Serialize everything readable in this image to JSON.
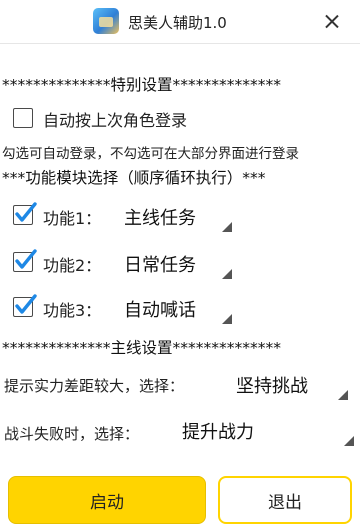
{
  "window": {
    "title": "思美人辅助1.0",
    "close_icon": "close-icon"
  },
  "special": {
    "header": "**************特别设置**************",
    "auto_login": {
      "label": "自动按上次角色登录",
      "checked": false
    },
    "hint": "勾选可自动登录，不勾选可在大部分界面进行登录"
  },
  "modules": {
    "header": "***功能模块选择（顺序循环执行）***",
    "items": [
      {
        "label": "功能1：",
        "value": "主线任务",
        "checked": true
      },
      {
        "label": "功能2：",
        "value": "日常任务",
        "checked": true
      },
      {
        "label": "功能3：",
        "value": "自动喊话",
        "checked": true
      }
    ]
  },
  "mainline": {
    "header": "**************主线设置**************",
    "power_gap": {
      "label": "提示实力差距较大，选择：",
      "value": "坚持挑战"
    },
    "battle_fail": {
      "label": "战斗失败时，选择：",
      "value": "提升战力"
    }
  },
  "buttons": {
    "start": "启动",
    "exit": "退出"
  },
  "colors": {
    "accent": "#ffd400",
    "check": "#1e88e5"
  }
}
